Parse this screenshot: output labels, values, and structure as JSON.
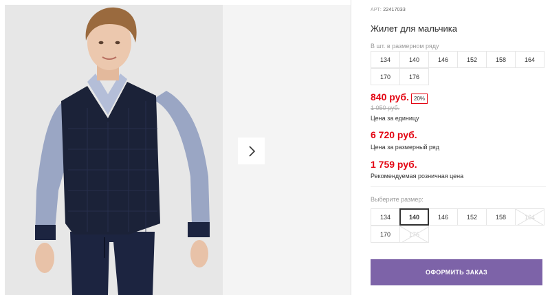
{
  "product": {
    "article_label": "АРТ:",
    "article_number": "22417033",
    "title": "Жилет для мальчика"
  },
  "size_range": {
    "label": "В шт. в размерном ряду",
    "sizes": [
      "134",
      "140",
      "146",
      "152",
      "158",
      "164",
      "170",
      "176"
    ]
  },
  "pricing": {
    "price": "840 руб.",
    "discount": "20%",
    "old_price": "1 050 руб.",
    "price_caption": "Цена за единицу",
    "series_price": "6 720 руб.",
    "series_caption": "Цена за размерный ряд",
    "retail_price": "1 759 руб.",
    "retail_caption": "Рекомендуемая розничная цена",
    "accent_color": "#e30613"
  },
  "size_selector": {
    "label": "Выберите размер:",
    "options": [
      {
        "size": "134",
        "state": "available"
      },
      {
        "size": "140",
        "state": "selected"
      },
      {
        "size": "146",
        "state": "available"
      },
      {
        "size": "152",
        "state": "available"
      },
      {
        "size": "158",
        "state": "available"
      },
      {
        "size": "164",
        "state": "unavailable"
      },
      {
        "size": "170",
        "state": "available"
      },
      {
        "size": "176",
        "state": "unavailable"
      }
    ]
  },
  "actions": {
    "order_label": "ОФОРМИТЬ ЗАКАЗ",
    "order_color": "#7d63a8"
  },
  "gallery": {
    "next_icon": "chevron-right-icon"
  }
}
